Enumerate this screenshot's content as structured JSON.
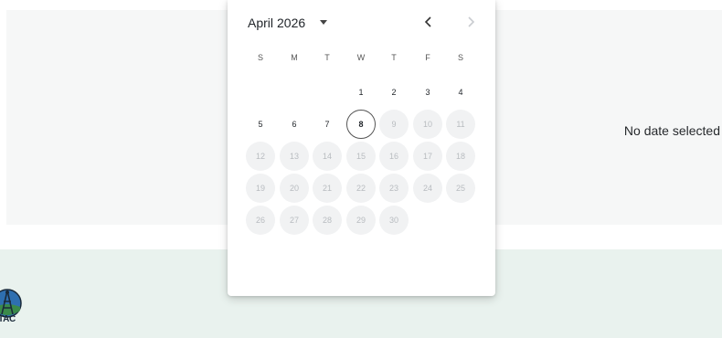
{
  "page": {
    "no_date_text": "No date selected"
  },
  "footer": {
    "logo_text": "TAC"
  },
  "datepicker": {
    "month": "April",
    "year": "2026",
    "weekdays": [
      "S",
      "M",
      "T",
      "W",
      "T",
      "F",
      "S"
    ],
    "days": [
      {
        "label": "1",
        "state": "enabled"
      },
      {
        "label": "2",
        "state": "enabled"
      },
      {
        "label": "3",
        "state": "enabled"
      },
      {
        "label": "4",
        "state": "enabled"
      },
      {
        "label": "5",
        "state": "enabled"
      },
      {
        "label": "6",
        "state": "enabled"
      },
      {
        "label": "7",
        "state": "enabled"
      },
      {
        "label": "8",
        "state": "today"
      },
      {
        "label": "9",
        "state": "disabled"
      },
      {
        "label": "10",
        "state": "disabled"
      },
      {
        "label": "11",
        "state": "disabled"
      },
      {
        "label": "12",
        "state": "disabled"
      },
      {
        "label": "13",
        "state": "disabled"
      },
      {
        "label": "14",
        "state": "disabled"
      },
      {
        "label": "15",
        "state": "disabled"
      },
      {
        "label": "16",
        "state": "disabled"
      },
      {
        "label": "17",
        "state": "disabled"
      },
      {
        "label": "18",
        "state": "disabled"
      },
      {
        "label": "19",
        "state": "disabled"
      },
      {
        "label": "20",
        "state": "disabled"
      },
      {
        "label": "21",
        "state": "disabled"
      },
      {
        "label": "22",
        "state": "disabled"
      },
      {
        "label": "23",
        "state": "disabled"
      },
      {
        "label": "24",
        "state": "disabled"
      },
      {
        "label": "25",
        "state": "disabled"
      },
      {
        "label": "26",
        "state": "disabled"
      },
      {
        "label": "27",
        "state": "disabled"
      },
      {
        "label": "28",
        "state": "disabled"
      },
      {
        "label": "29",
        "state": "disabled"
      },
      {
        "label": "30",
        "state": "disabled"
      }
    ],
    "icons": {
      "caret": "caret-down-icon",
      "prev": "chevron-left-icon",
      "next": "chevron-right-icon"
    }
  },
  "colors": {
    "content_bg": "#f6f7f7",
    "footer_bg": "#e9f2ee",
    "disabled_day_bg": "#f1f2f3",
    "disabled_day_text": "#b8bcc0"
  }
}
